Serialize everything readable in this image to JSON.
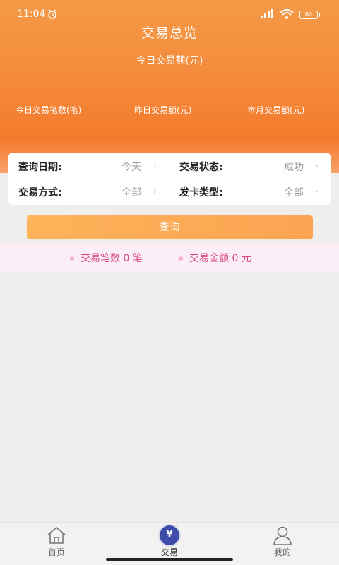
{
  "status_bar": {
    "time": "11:04",
    "battery": "60"
  },
  "header": {
    "title": "交易总览",
    "today_amount_label": "今日交易额(元)",
    "stats": [
      {
        "label": "今日交易笔数(笔)"
      },
      {
        "label": "昨日交易额(元)"
      },
      {
        "label": "本月交易额(元)"
      }
    ]
  },
  "filters": {
    "query_date_label": "查询日期:",
    "query_date_value": "今天",
    "trade_status_label": "交易状态:",
    "trade_status_value": "成功",
    "trade_method_label": "交易方式:",
    "trade_method_value": "全部",
    "card_type_label": "发卡类型:",
    "card_type_value": "全部"
  },
  "query_button": "查询",
  "summary": {
    "count_text": "交易笔数  0 笔",
    "amount_text": "交易金额  0 元"
  },
  "tabbar": {
    "items": [
      {
        "label": "首页",
        "icon": "home-icon"
      },
      {
        "label": "交易",
        "icon": "yen-icon",
        "glyph": "¥"
      },
      {
        "label": "我的",
        "icon": "user-icon"
      }
    ],
    "active": "交易"
  },
  "colors": {
    "header_orange": "#f58a3c",
    "button_orange": "#fdb35a",
    "summary_pink": "#d64a7a",
    "tab_active_blue": "#3f4ba8"
  }
}
